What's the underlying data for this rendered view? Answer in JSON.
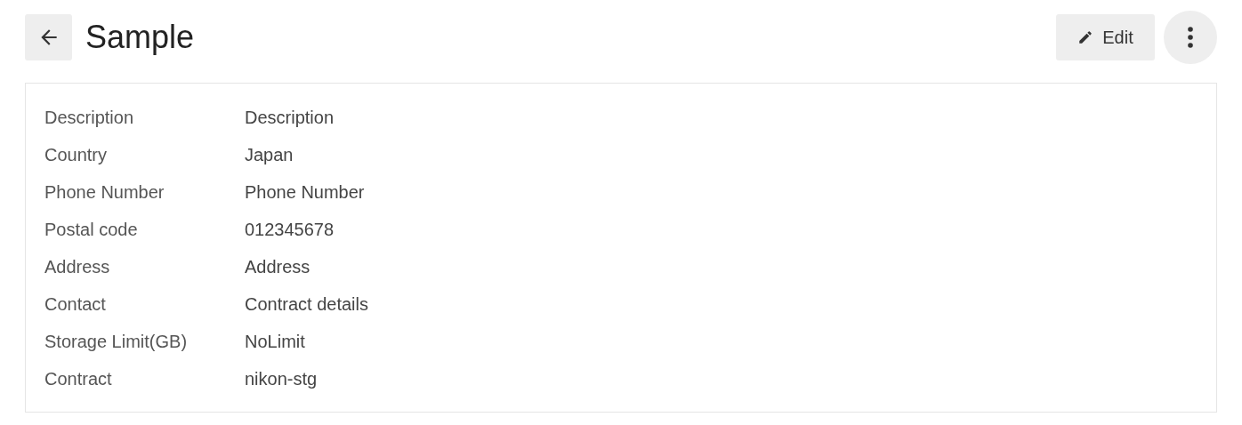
{
  "header": {
    "title": "Sample",
    "edit_button": "Edit"
  },
  "details": [
    {
      "label": "Description",
      "value": "Description"
    },
    {
      "label": "Country",
      "value": "Japan"
    },
    {
      "label": "Phone Number",
      "value": "Phone Number"
    },
    {
      "label": "Postal code",
      "value": "012345678"
    },
    {
      "label": "Address",
      "value": "Address"
    },
    {
      "label": "Contact",
      "value": "Contract details"
    },
    {
      "label": "Storage Limit(GB)",
      "value": "NoLimit"
    },
    {
      "label": "Contract",
      "value": "nikon-stg"
    }
  ]
}
